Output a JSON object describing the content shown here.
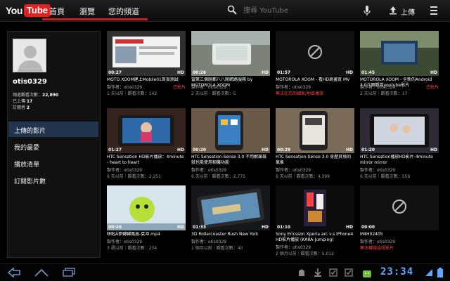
{
  "header": {
    "logo_you": "You",
    "logo_tube": "Tube",
    "tabs": [
      {
        "label": "首頁",
        "active": false
      },
      {
        "label": "瀏覽",
        "active": false
      },
      {
        "label": "您的頻道",
        "active": true
      }
    ],
    "search_placeholder": "搜尋 YouTube",
    "upload_label": "上傳",
    "icons": [
      "search-icon",
      "mic-icon",
      "upload-icon",
      "menu-icon"
    ],
    "accent_color": "#d92020"
  },
  "sidebar": {
    "username": "otis0329",
    "stats": [
      {
        "label": "頻道觀看次數：",
        "value": "22,890"
      },
      {
        "label": "已上傳 ",
        "value": "17"
      },
      {
        "label": "訂閱者 ",
        "value": "2"
      }
    ],
    "menu": [
      {
        "label": "上傳的影片",
        "active": true
      },
      {
        "label": "我的最愛",
        "active": false
      },
      {
        "label": "播放清單",
        "active": false
      },
      {
        "label": "訂閱影片數",
        "active": false
      }
    ]
  },
  "videos": [
    {
      "duration": "00:27",
      "hd": "HD",
      "title": "MOTO XOOM建上Mobile01首頁測試",
      "author": "製作者：otis0329",
      "status": "已影片",
      "meta": "1 天以前｜觀看次數：142"
    },
    {
      "duration": "00:26",
      "hd": "HD",
      "title": "當第三個腕都八八開網路服務 by MOTOROLA XOOM",
      "author": "製作者：otis0329",
      "status": "",
      "meta": "2 天以前｜觀看次數：5"
    },
    {
      "duration": "01:57",
      "hd": "HD",
      "title": "MOTOROLA XOOM - 看HD高畫質 MV",
      "author": "製作者：otis0329",
      "status": "",
      "meta": "無法在您的國家/地區播放"
    },
    {
      "duration": "01:45",
      "hd": "HD",
      "title": "MOTOROLA XOOM - 全新的Android 3.0介面觀賞youtube影片",
      "author": "製作者：otis0329",
      "status": "已影片",
      "meta": "2 天以前｜觀看次數：17"
    },
    {
      "duration": "01:27",
      "hd": "HD",
      "title": "HTC Sensation HD影片播放：4minute - heart to heart",
      "author": "製作者：otis0329",
      "status": "",
      "meta": "6 天以前｜觀看次數：2,251"
    },
    {
      "duration": "00:20",
      "hd": "HD",
      "title": "HTC Sensation-Sense 3.0 不用解鎖幕就也能使用相機功能",
      "author": "製作者：otis0329",
      "status": "",
      "meta": "6 天以前｜觀看次數：2,775"
    },
    {
      "duration": "00:29",
      "hd": "HD",
      "title": "HTC Sensation-Sense 3.0 身歷其境的氣象",
      "author": "製作者：otis0329",
      "status": "",
      "meta": "6 天以前｜觀看次數：4,399"
    },
    {
      "duration": "01:20",
      "hd": "HD",
      "title": "HTC Sensation播放HD影片-4minute mirror mirror",
      "author": "製作者：otis0329",
      "status": "",
      "meta": "6 天以前｜觀看次數：559"
    },
    {
      "duration": "00:26",
      "hd": "HD",
      "title": "哆啦A夢轉轉風扇-袁冲.mp4",
      "author": "製作者：otis0329",
      "status": "",
      "meta": "3 週以前｜觀看次數：234"
    },
    {
      "duration": "01:33",
      "hd": "HD",
      "title": "3D Rollercoaster Rush New York",
      "author": "製作者：otis0329",
      "status": "",
      "meta": "1 個月以前｜觀看次數：40"
    },
    {
      "duration": "01:10",
      "hd": "HD",
      "title": "Sony Ericsson Xperia arc v.s iPhone4 HD影片播放 (KARA-Jumping)",
      "author": "製作者：otis0329",
      "status": "",
      "meta": "2 個月以前｜觀看次數：5,012"
    },
    {
      "duration": "00:00",
      "hd": "",
      "title": "M4H02405",
      "author": "製作者：otis0329",
      "status": "",
      "meta": "無法轉換這段影片"
    }
  ],
  "systembar": {
    "clock": "23:34",
    "icons": [
      "back-icon",
      "home-icon",
      "recent-apps-icon",
      "android-icon",
      "download-icon",
      "check-icon",
      "check-icon",
      "market-icon",
      "wifi-icon",
      "battery-icon"
    ],
    "clock_color": "#5aa8ff"
  }
}
